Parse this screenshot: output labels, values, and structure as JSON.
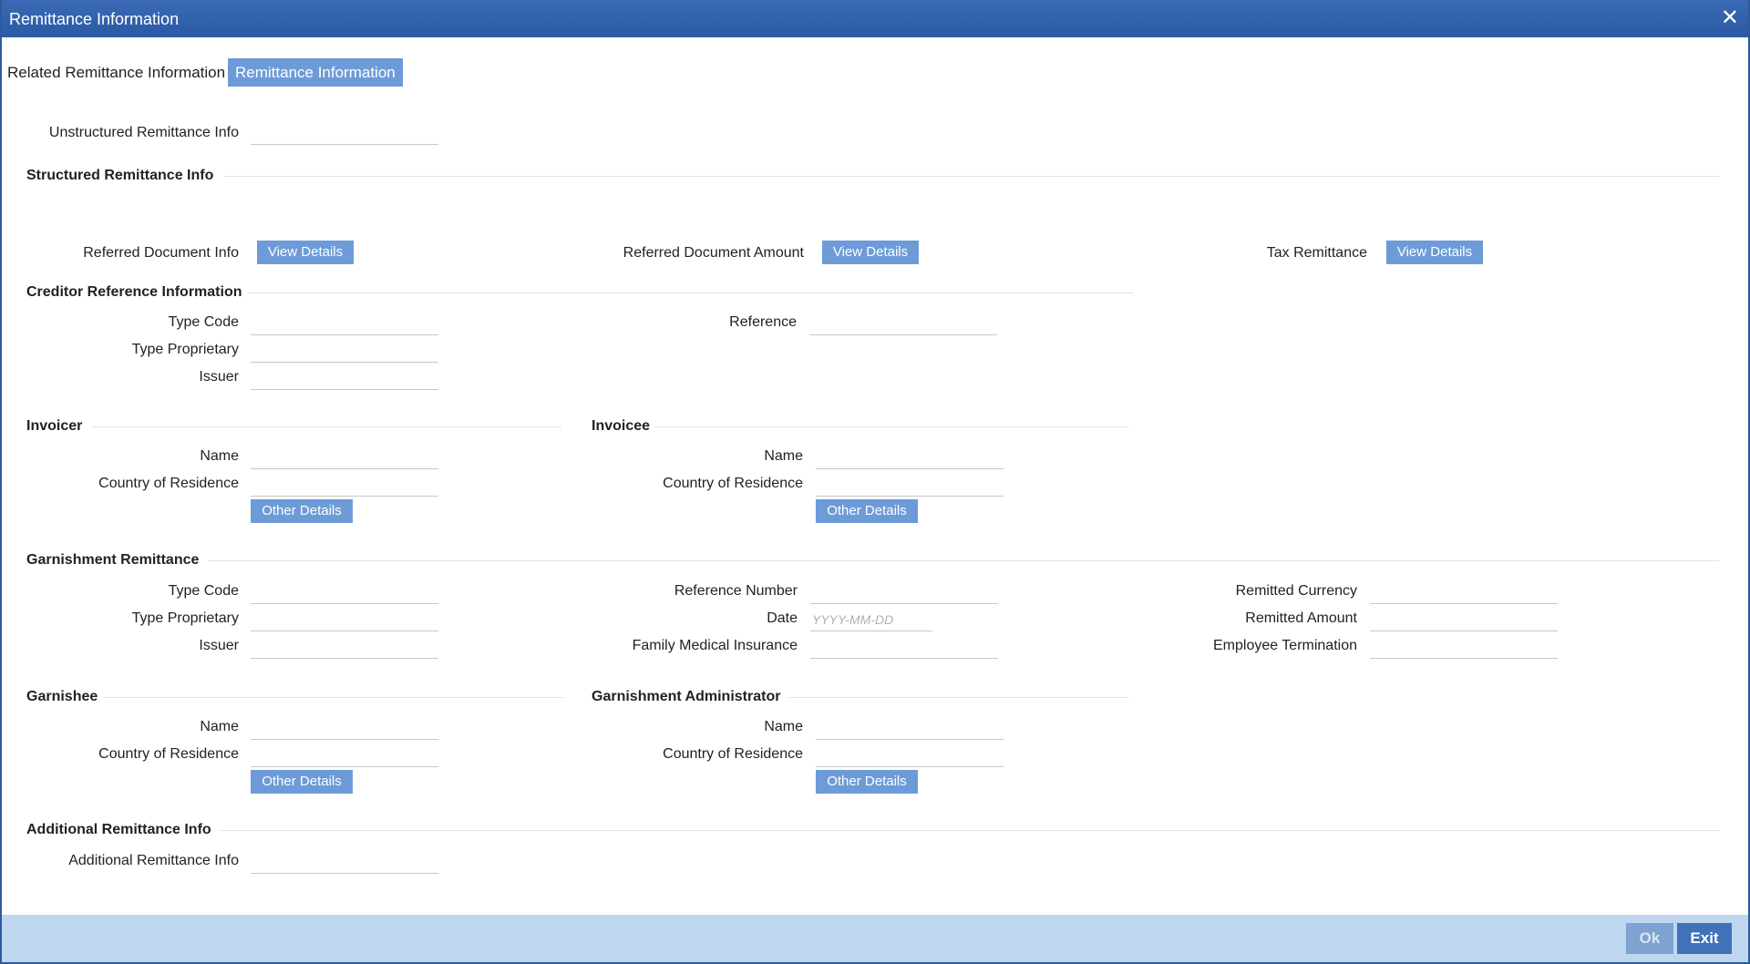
{
  "window": {
    "title": "Remittance Information",
    "close_glyph": "✕"
  },
  "tabs": {
    "related": "Related Remittance Information",
    "active": "Remittance Information"
  },
  "unstructured": {
    "label": "Unstructured Remittance Info",
    "value": ""
  },
  "structured": {
    "heading": "Structured Remittance Info",
    "referred_document_info": "Referred Document Info",
    "referred_document_amount": "Referred Document Amount",
    "tax_remittance": "Tax Remittance",
    "view_details": "View Details"
  },
  "creditor": {
    "heading": "Creditor Reference Information",
    "type_code": "Type Code",
    "type_proprietary": "Type Proprietary",
    "issuer": "Issuer",
    "reference": "Reference"
  },
  "invoicer": {
    "heading": "Invoicer",
    "name": "Name",
    "country": "Country of Residence",
    "other_details": "Other Details"
  },
  "invoicee": {
    "heading": "Invoicee",
    "name": "Name",
    "country": "Country of Residence",
    "other_details": "Other Details"
  },
  "garnishment": {
    "heading": "Garnishment Remittance",
    "type_code": "Type Code",
    "type_proprietary": "Type Proprietary",
    "issuer": "Issuer",
    "reference_number": "Reference Number",
    "date": "Date",
    "date_placeholder": "YYYY-MM-DD",
    "family_medical_insurance": "Family Medical Insurance",
    "remitted_currency": "Remitted Currency",
    "remitted_amount": "Remitted Amount",
    "employee_termination": "Employee Termination"
  },
  "garnishee": {
    "heading": "Garnishee",
    "name": "Name",
    "country": "Country of Residence",
    "other_details": "Other Details"
  },
  "garnishment_admin": {
    "heading": "Garnishment Administrator",
    "name": "Name",
    "country": "Country of Residence",
    "other_details": "Other Details"
  },
  "additional": {
    "heading": "Additional Remittance Info",
    "label": "Additional Remittance Info"
  },
  "footer": {
    "ok": "Ok",
    "exit": "Exit"
  },
  "colors": {
    "titlebar": "#2b5aa4",
    "button": "#6c9bd8",
    "footer": "#bfd7ee",
    "exit": "#3f72b9"
  }
}
